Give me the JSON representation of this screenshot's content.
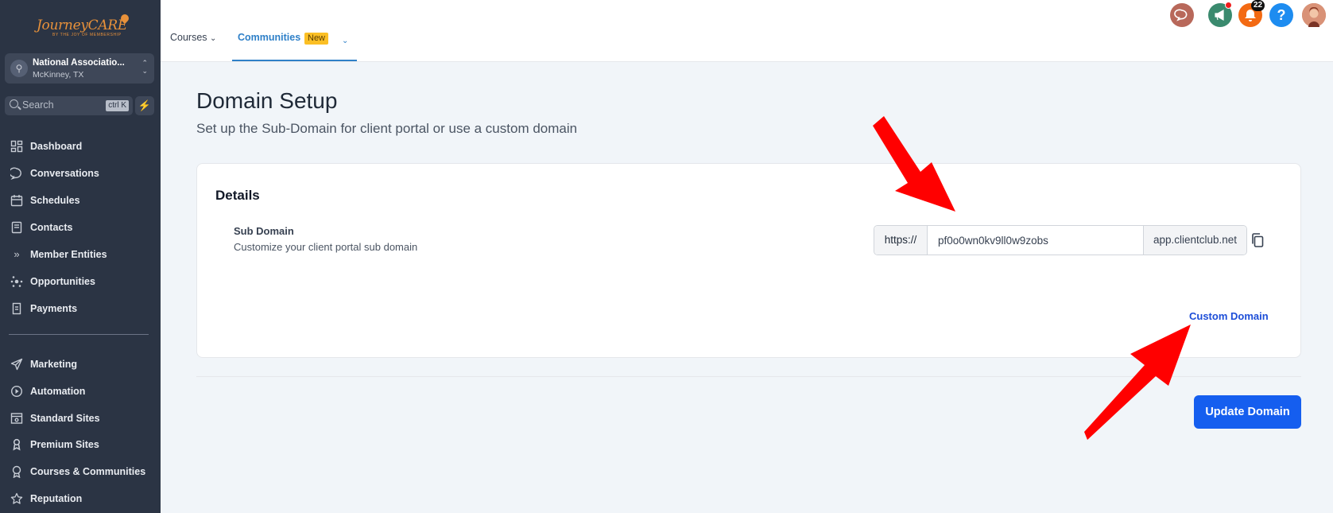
{
  "brand": {
    "logo_text": "JourneyCARE",
    "tagline": "BY THE JOY OF MEMBERSHIP"
  },
  "account": {
    "name": "National Associatio...",
    "location": "McKinney, TX"
  },
  "search": {
    "placeholder": "Search",
    "shortcut": "ctrl K"
  },
  "sidebar": {
    "items": [
      {
        "label": "Dashboard",
        "icon": "dashboard-icon"
      },
      {
        "label": "Conversations",
        "icon": "chat-icon"
      },
      {
        "label": "Schedules",
        "icon": "calendar-icon"
      },
      {
        "label": "Contacts",
        "icon": "contacts-icon"
      },
      {
        "label": "Member Entities",
        "icon": "double-chevron-icon"
      },
      {
        "label": "Opportunities",
        "icon": "opportunities-icon"
      },
      {
        "label": "Payments",
        "icon": "payments-icon"
      }
    ],
    "items2": [
      {
        "label": "Marketing",
        "icon": "send-icon"
      },
      {
        "label": "Automation",
        "icon": "automation-icon"
      },
      {
        "label": "Standard Sites",
        "icon": "sites-icon"
      },
      {
        "label": "Premium Sites",
        "icon": "premium-icon"
      },
      {
        "label": "Courses & Communities",
        "icon": "award-icon"
      },
      {
        "label": "Reputation",
        "icon": "star-icon"
      }
    ]
  },
  "topbar": {
    "tabs": [
      {
        "label": "Courses"
      },
      {
        "label": "Communities",
        "badge": "New"
      }
    ],
    "notification_count": "22",
    "help_label": "?"
  },
  "main": {
    "title": "Domain Setup",
    "subtitle": "Set up the Sub-Domain for client portal or use a custom domain",
    "card": {
      "title": "Details",
      "field_label": "Sub Domain",
      "field_desc": "Customize your client portal sub domain",
      "prefix": "https://",
      "subdomain_value": "pf0o0wn0kv9ll0w9zobs",
      "suffix": "app.clientclub.net",
      "custom_domain_link": "Custom Domain"
    },
    "update_button": "Update Domain"
  },
  "colors": {
    "sidebar_bg": "#2b3444",
    "accent": "#155eef",
    "tab_active": "#2f80c8",
    "annotation_arrow": "#ff0000"
  }
}
